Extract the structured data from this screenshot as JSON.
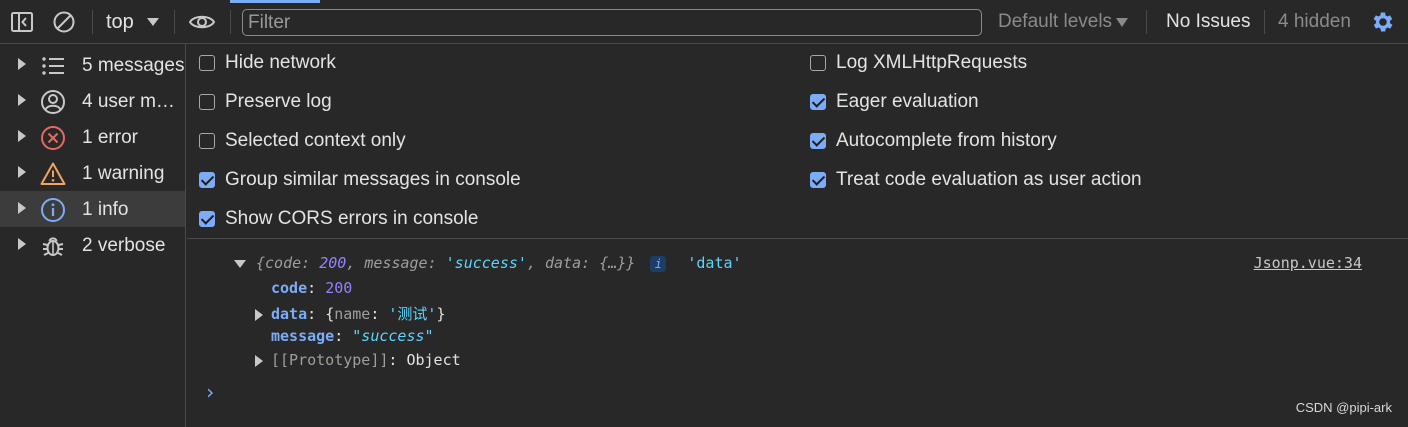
{
  "toolbar": {
    "context": "top",
    "filter_placeholder": "Filter",
    "levels": "Default levels",
    "issues": "No Issues",
    "hidden": "4 hidden"
  },
  "sidebar": {
    "items": [
      {
        "label": "5 messages",
        "icon": "list-icon"
      },
      {
        "label": "4 user messages",
        "icon": "user-icon"
      },
      {
        "label": "1 error",
        "icon": "error-icon"
      },
      {
        "label": "1 warning",
        "icon": "warning-icon"
      },
      {
        "label": "1 info",
        "icon": "info-icon",
        "selected": true
      },
      {
        "label": "2 verbose",
        "icon": "bug-icon"
      }
    ]
  },
  "settings": {
    "left": [
      {
        "label": "Hide network",
        "checked": false
      },
      {
        "label": "Preserve log",
        "checked": false
      },
      {
        "label": "Selected context only",
        "checked": false
      },
      {
        "label": "Group similar messages in console",
        "checked": true
      },
      {
        "label": "Show CORS errors in console",
        "checked": true
      }
    ],
    "right": [
      {
        "label": "Log XMLHttpRequests",
        "checked": false
      },
      {
        "label": "Eager evaluation",
        "checked": true
      },
      {
        "label": "Autocomplete from history",
        "checked": true
      },
      {
        "label": "Treat code evaluation as user action",
        "checked": true
      }
    ]
  },
  "console": {
    "summary": {
      "open": "{",
      "code_key": "code",
      "code_val": "200",
      "message_key": "message",
      "message_val": "'success'",
      "data_key": "data",
      "data_val": "{…}",
      "close": "}",
      "info_badge": "i",
      "label": "'data'"
    },
    "source": "Jsonp.vue:34",
    "props": {
      "code_key": "code",
      "code_val": "200",
      "data_key": "data",
      "data_preview_open": "{",
      "data_preview_key": "name",
      "data_preview_val": "'测试'",
      "data_preview_close": "}",
      "message_key": "message",
      "message_val": "\"success\"",
      "proto_key": "[[Prototype]]",
      "proto_val": "Object"
    },
    "prompt": "›"
  },
  "watermark": "CSDN @pipi-ark",
  "colors": {
    "background": "#282828",
    "accent": "#7cacf8",
    "string": "#5cd5fb",
    "number": "#9980ff",
    "error": "#e46962",
    "warning": "#f2a35e"
  }
}
